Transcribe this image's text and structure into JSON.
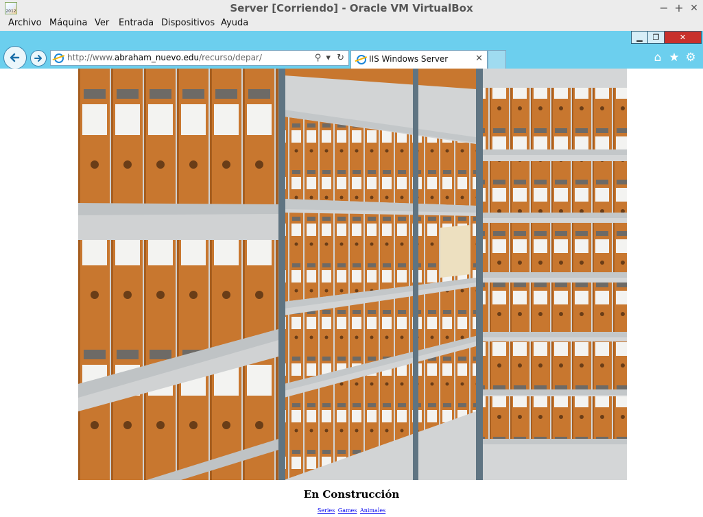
{
  "vbox": {
    "title": "Server [Corriendo] - Oracle VM VirtualBox",
    "icon_text": "2012",
    "controls": {
      "minimize": "−",
      "maximize": "+",
      "close": "✕"
    },
    "menu": [
      "Archivo",
      "Máquina",
      "Ver",
      "Entrada",
      "Dispositivos",
      "Ayuda"
    ]
  },
  "browser": {
    "window_controls": {
      "minimize": "▁",
      "restore": "❐",
      "close": "✕"
    },
    "back_icon": "arrow-left-icon",
    "forward_icon": "arrow-right-icon",
    "address": {
      "prefix": "http://www.",
      "domain": "abraham_nuevo.edu",
      "path": "/recurso/depar/",
      "search_glyph": "⚲",
      "dropdown_glyph": "▾",
      "refresh_glyph": "↻"
    },
    "tab": {
      "title": "IIS Windows Server",
      "close_glyph": "✕"
    },
    "toolbar": {
      "home_glyph": "⌂",
      "favorites_glyph": "★",
      "settings_glyph": "⚙"
    }
  },
  "page": {
    "image_alt": "archive-shelves-photo",
    "heading": "En Construcción",
    "links": [
      "Series",
      "Games",
      "Animales"
    ]
  },
  "colors": {
    "ie_frame": "#6ccfee",
    "vbox_bar": "#ececec",
    "close_button": "#c8302c",
    "box_orange": "#c8772f",
    "shelf_grey": "#c6cacc",
    "upright_blue": "#5f7482"
  }
}
